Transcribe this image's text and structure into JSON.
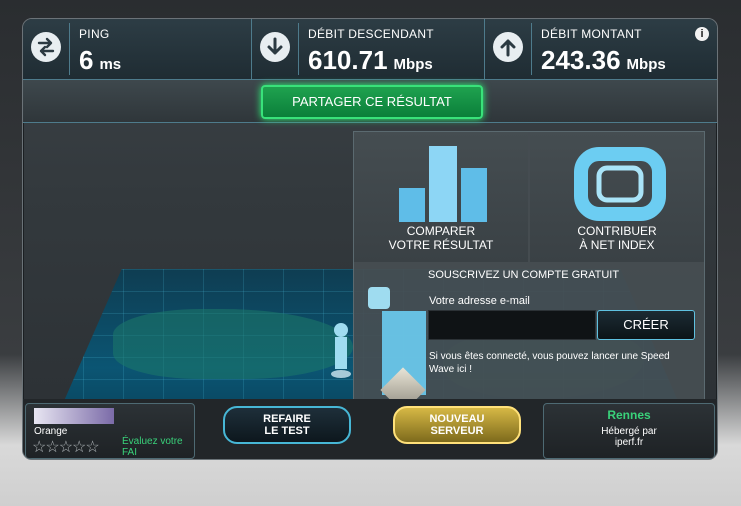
{
  "metrics": {
    "ping": {
      "label": "PING",
      "value": "6",
      "unit": "ms"
    },
    "download": {
      "label": "DÉBIT DESCENDANT",
      "value": "610.71",
      "unit": "Mbps"
    },
    "upload": {
      "label": "DÉBIT MONTANT",
      "value": "243.36",
      "unit": "Mbps"
    },
    "info_icon": "i"
  },
  "share_button": "PARTAGER CE RÉSULTAT",
  "tiles": [
    {
      "label_line1": "COMPARER",
      "label_line2": "VOTRE RÉSULTAT"
    },
    {
      "label_line1": "CONTRIBUER",
      "label_line2": "À NET INDEX"
    }
  ],
  "subscribe": {
    "title": "SOUSCRIVEZ UN COMPTE GRATUIT",
    "email_label": "Votre adresse e-mail",
    "email_value": "",
    "create_button": "CRÉER",
    "note": "Si vous êtes connecté, vous pouvez lancer une Speed Wave ici !"
  },
  "isp": {
    "name": "Orange",
    "rate_line1": "Évaluez votre",
    "rate_line2": "FAI",
    "stars": "☆☆☆☆☆"
  },
  "buttons": {
    "retest_line1": "REFAIRE",
    "retest_line2": "LE TEST",
    "new_server_line1": "NOUVEAU",
    "new_server_line2": "SERVEUR"
  },
  "server": {
    "city": "Rennes",
    "hosted_line1": "Hébergé par",
    "hosted_line2": "iperf.fr"
  },
  "colors": {
    "accent_green": "#39d27a",
    "accent_cyan": "#47b7d6",
    "accent_gold": "#d6b845"
  }
}
